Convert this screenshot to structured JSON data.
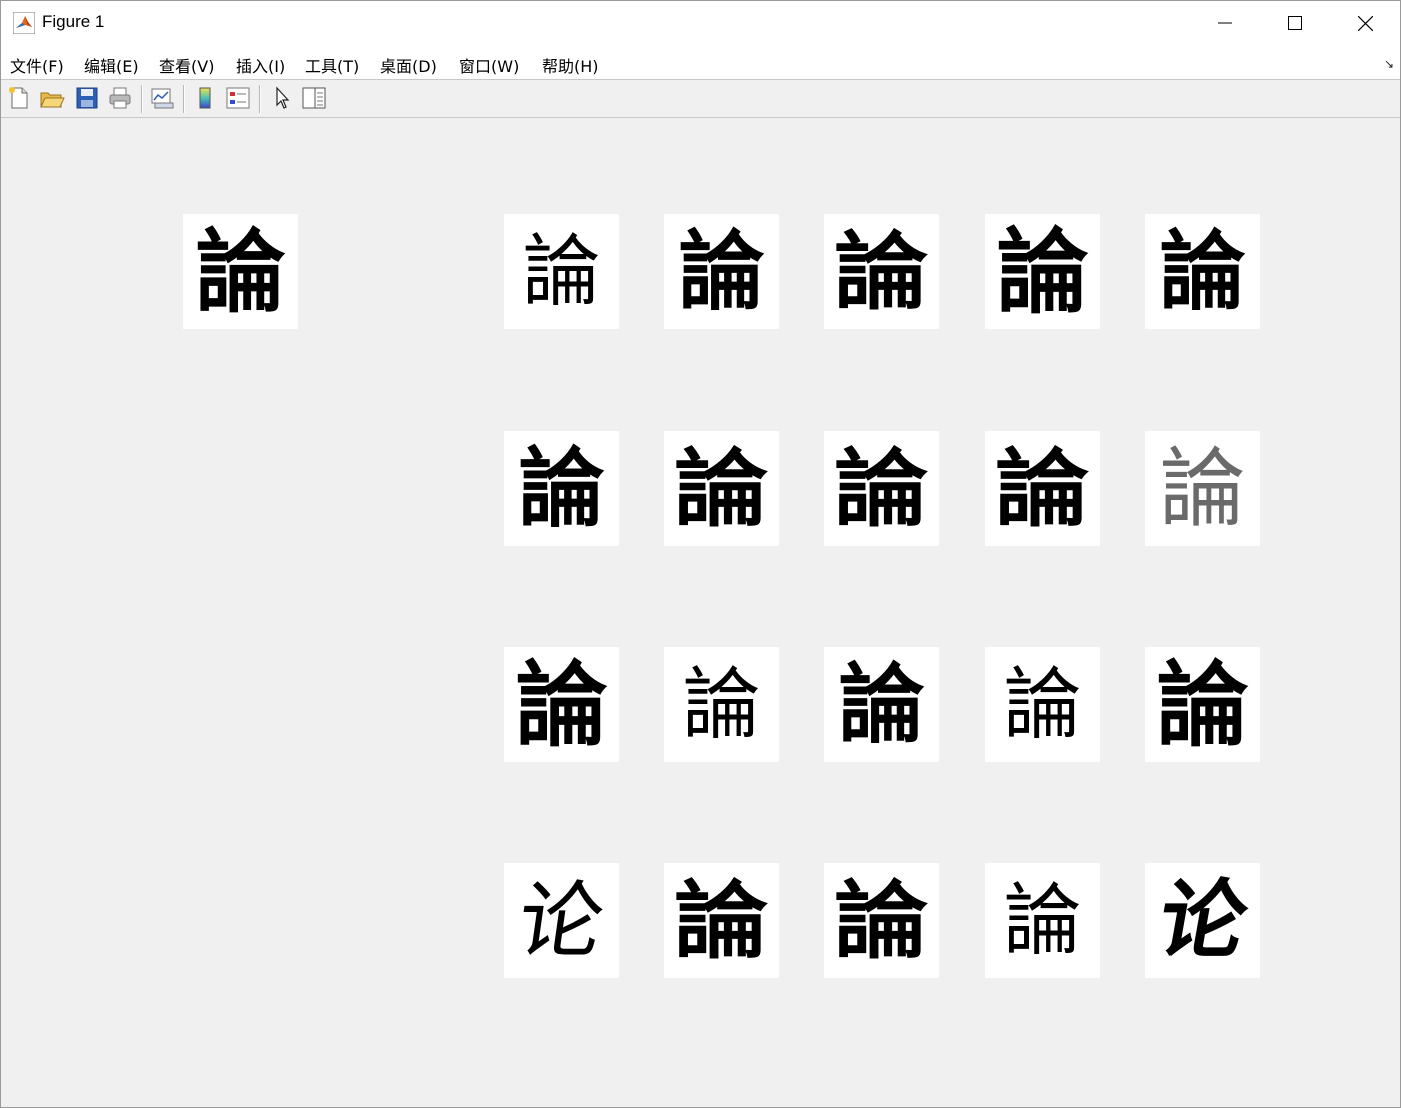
{
  "window": {
    "title": "Figure 1",
    "controls": [
      "minimize",
      "maximize",
      "close"
    ]
  },
  "menubar": {
    "items": [
      "文件(F)",
      "编辑(E)",
      "查看(V)",
      "插入(I)",
      "工具(T)",
      "桌面(D)",
      "窗口(W)",
      "帮助(H)"
    ]
  },
  "toolbar": {
    "buttons": [
      "new-figure-icon",
      "open-file-icon",
      "save-icon",
      "print-icon",
      "link-plot-icon",
      "colorbar-icon",
      "legend-icon",
      "edit-plot-icon",
      "property-editor-icon"
    ]
  },
  "figure": {
    "query": {
      "character": "論",
      "style": "regular"
    },
    "results": [
      {
        "character": "論",
        "style": "thin"
      },
      {
        "character": "論",
        "style": "regular"
      },
      {
        "character": "論",
        "style": "heavy"
      },
      {
        "character": "論",
        "style": "bold"
      },
      {
        "character": "論",
        "style": "regular"
      },
      {
        "character": "論",
        "style": "regular"
      },
      {
        "character": "論",
        "style": "heavy"
      },
      {
        "character": "論",
        "style": "heavy"
      },
      {
        "character": "論",
        "style": "heavy"
      },
      {
        "character": "論",
        "style": "faint"
      },
      {
        "character": "論",
        "style": "bold"
      },
      {
        "character": "論",
        "style": "thin"
      },
      {
        "character": "論",
        "style": "regular"
      },
      {
        "character": "論",
        "style": "thin"
      },
      {
        "character": "論",
        "style": "bold"
      },
      {
        "character": "论",
        "style": "cursive"
      },
      {
        "character": "論",
        "style": "heavy"
      },
      {
        "character": "論",
        "style": "heavy"
      },
      {
        "character": "論",
        "style": "thin"
      },
      {
        "character": "论",
        "style": "cursive-bold"
      }
    ]
  }
}
